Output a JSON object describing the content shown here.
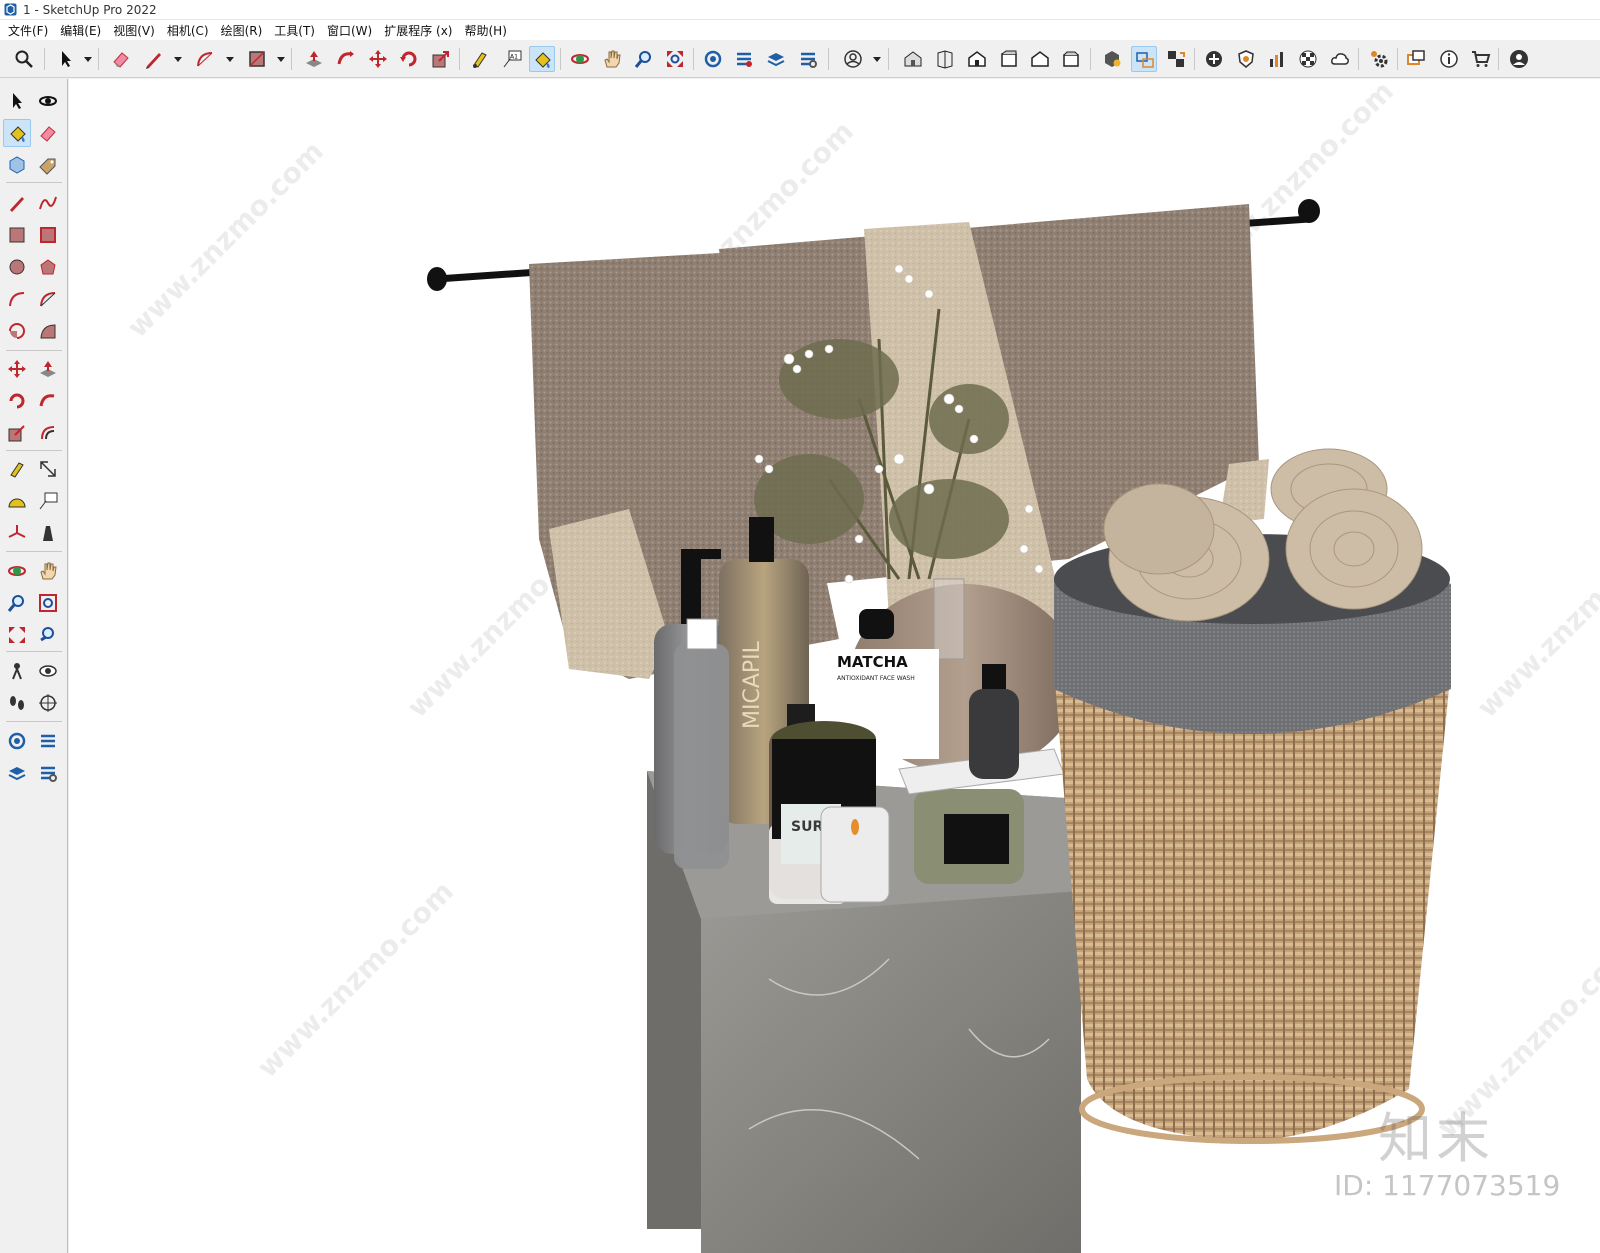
{
  "window": {
    "title": "1 - SketchUp Pro 2022"
  },
  "menu": {
    "items": [
      {
        "label": "文件(F)"
      },
      {
        "label": "编辑(E)"
      },
      {
        "label": "视图(V)"
      },
      {
        "label": "相机(C)"
      },
      {
        "label": "绘图(R)"
      },
      {
        "label": "工具(T)"
      },
      {
        "label": "窗口(W)"
      },
      {
        "label": "扩展程序 (x)"
      },
      {
        "label": "帮助(H)"
      }
    ]
  },
  "toolbar": {
    "active_tool": "paint-bucket",
    "tools": [
      "zoom-extents-icon",
      "select-icon",
      "eraser-icon",
      "line-icon",
      "arc-icon",
      "rectangle-icon",
      "push-pull-icon",
      "follow-me-icon",
      "move-icon",
      "rotate-icon",
      "scale-icon",
      "tape-measure-icon",
      "text-icon",
      "paint-bucket-icon",
      "orbit-icon",
      "pan-icon",
      "zoom-icon",
      "zoom-window-icon",
      "warehouse-icon",
      "extension-warehouse-icon",
      "layout-icon",
      "extension-manager-icon",
      "account-icon",
      "iso-view-icon",
      "top-view-icon",
      "front-view-icon",
      "right-view-icon",
      "back-view-icon",
      "left-view-icon",
      "solid-tools-icon",
      "sandbox-icon",
      "section-icon",
      "add-location-icon",
      "shadow-icon",
      "style-icon",
      "texture-icon",
      "cloud-icon",
      "settings-icon",
      "message-icon",
      "info-icon",
      "cart-icon",
      "user-icon"
    ]
  },
  "left_toolbar": {
    "active_tool": "paint-bucket",
    "tools": [
      "select-icon",
      "orbit-icon",
      "paint-bucket-icon",
      "eraser-icon",
      "component-icon",
      "tag-icon",
      "line-icon",
      "freehand-icon",
      "rectangle-icon",
      "rotated-rectangle-icon",
      "circle-icon",
      "polygon-icon",
      "arc-icon",
      "two-point-arc-icon",
      "pie-icon",
      "three-point-arc-icon",
      "move-icon",
      "push-pull-icon",
      "rotate-icon",
      "follow-me-icon",
      "scale-icon",
      "offset-icon",
      "tape-measure-icon",
      "dimension-icon",
      "protractor-icon",
      "text-icon",
      "axes-icon",
      "3d-text-icon",
      "orbit-tool-icon",
      "pan-tool-icon",
      "zoom-tool-icon",
      "zoom-window-tool-icon",
      "zoom-extents-tool-icon",
      "previous-view-icon",
      "position-camera-icon",
      "look-around-icon",
      "walk-icon",
      "section-plane-icon",
      "warehouse-icon",
      "extension-warehouse-icon",
      "layout-icon",
      "extension-manager-icon"
    ]
  },
  "viewport": {
    "scene_description_label": "",
    "product_labels": {
      "matcha": "MATCHA",
      "matcha_sub": "ANTIOXIDANT FACE WASH",
      "pump_bottle": "MICAPIL",
      "jar": "SUR SOL"
    },
    "watermark": {
      "domain": "www.znzmo.com",
      "brand": "知末网",
      "logo": "知末",
      "id": "ID: 1177073519"
    }
  },
  "colors": {
    "ui_bg": "#f0f0f0",
    "active_highlight": "#cce4f7",
    "viewport_bg": "#ffffff"
  }
}
